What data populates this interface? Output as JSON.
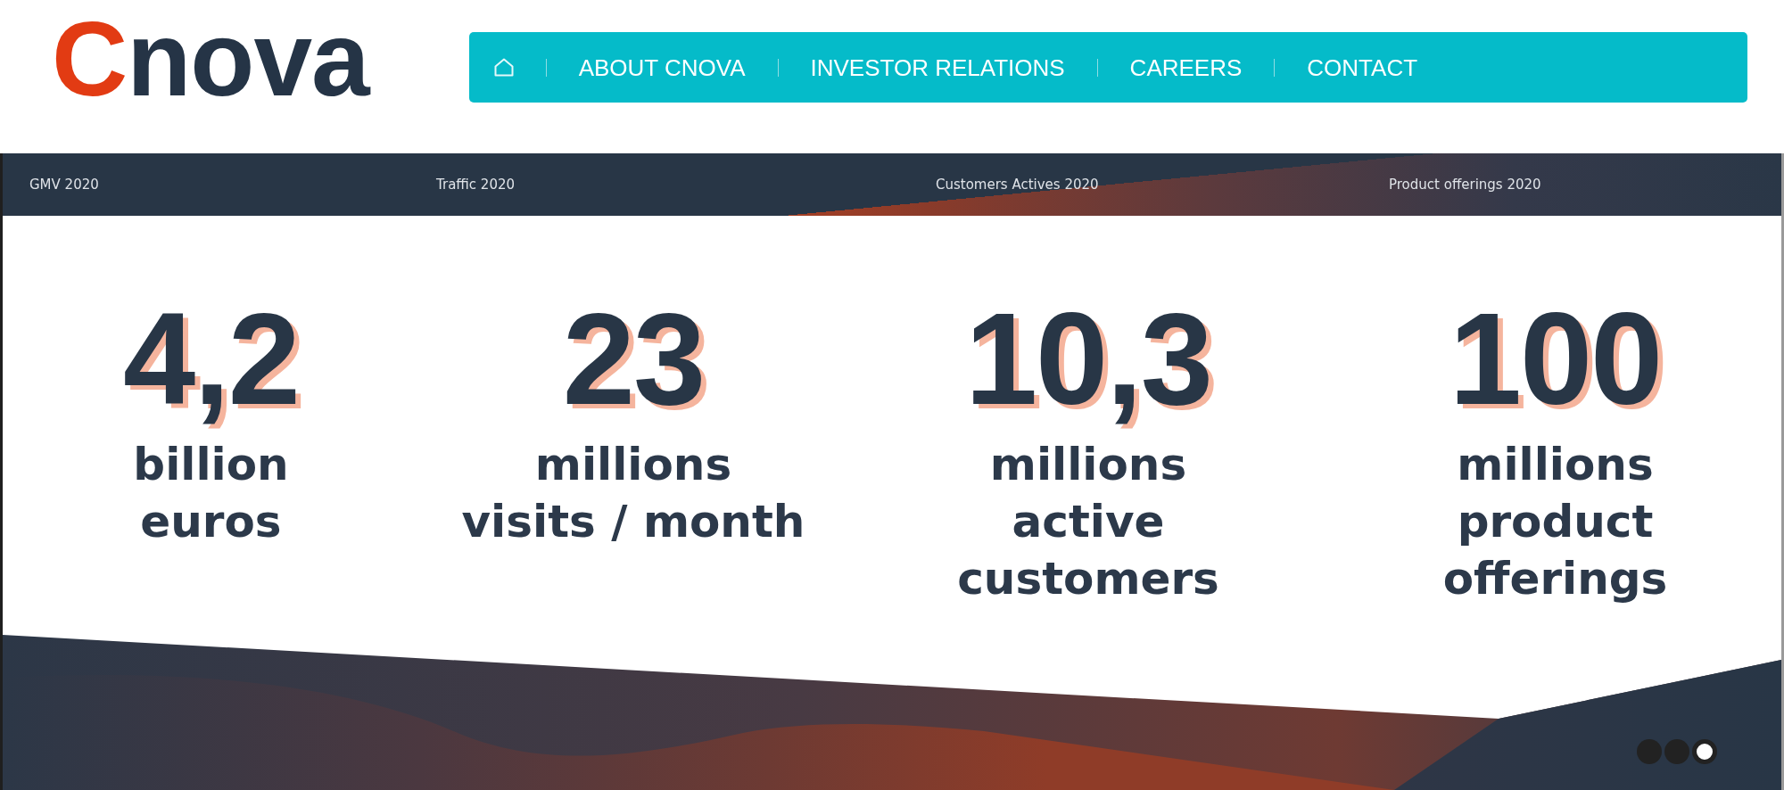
{
  "logo": {
    "parts": [
      {
        "text": "C",
        "color": "#e23b13"
      },
      {
        "text": "nova",
        "color": "#253446"
      }
    ]
  },
  "nav": {
    "items": [
      {
        "kind": "home"
      },
      {
        "kind": "link",
        "label": "ABOUT CNOVA"
      },
      {
        "kind": "link",
        "label": "INVESTOR RELATIONS"
      },
      {
        "kind": "link",
        "label": "CAREERS"
      },
      {
        "kind": "link",
        "label": "CONTACT"
      }
    ]
  },
  "banner": {
    "header_labels": [
      "GMV 2020",
      "Traffic 2020",
      "Customers Actives 2020",
      "Product offerings 2020"
    ],
    "stats": [
      {
        "value": "4,2",
        "caption_lines": [
          "billion",
          "euros"
        ]
      },
      {
        "value": "23",
        "caption_lines": [
          "millions",
          "visits / month"
        ]
      },
      {
        "value": "10,3",
        "caption_lines": [
          "millions",
          "active",
          "customers"
        ]
      },
      {
        "value": "100",
        "caption_lines": [
          "millions",
          "product",
          "offerings"
        ]
      }
    ]
  },
  "carousel": {
    "dots": [
      {
        "selected": false
      },
      {
        "selected": false
      },
      {
        "selected": true
      }
    ]
  }
}
